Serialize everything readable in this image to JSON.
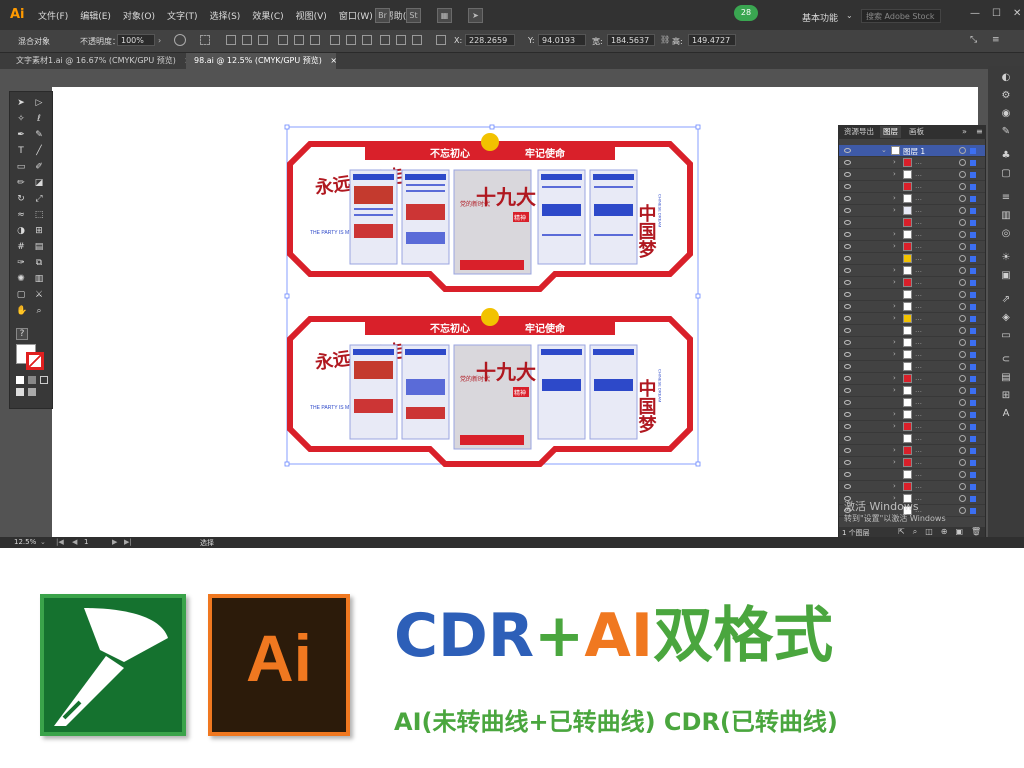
{
  "menubar": {
    "app_logo": "Ai",
    "menus": [
      "文件(F)",
      "编辑(E)",
      "对象(O)",
      "文字(T)",
      "选择(S)",
      "效果(C)",
      "视图(V)",
      "窗口(W)",
      "帮助(H)"
    ],
    "notification_count": "28",
    "workspace": "基本功能",
    "search_placeholder": "搜索 Adobe Stock"
  },
  "control_bar": {
    "selection_label": "混合对象",
    "opacity_label": "不透明度：",
    "opacity_value": "100%",
    "x_label": "X:",
    "x_value": "228.2659",
    "y_label": "Y:",
    "y_value": "94.0193",
    "w_label": "宽:",
    "w_value": "184.5637",
    "h_label": "高:",
    "h_value": "149.4727"
  },
  "tabs": [
    {
      "label": "文字素材1.ai @ 16.67% (CMYK/GPU 预览)",
      "active": false
    },
    {
      "label": "98.ai @ 12.5% (CMYK/GPU 预览)",
      "active": true
    }
  ],
  "status_bar": {
    "zoom": "12.5%",
    "artboard": "1",
    "tool_status": "选择"
  },
  "layers_panel": {
    "tabs": [
      "资源导出",
      "图层",
      "画板"
    ],
    "top_layer": "图层 1",
    "layer_count": "1 个图层",
    "accent_color": "#3c6ff2"
  },
  "artwork": {
    "banner_left": "不忘初心",
    "banner_right": "牢记使命",
    "left_slogan": "永远跟党走",
    "left_slogan_en": "THE PARTY IS MY HEART",
    "center_title": "十九大",
    "center_tag": "精神",
    "center_subtitle": "党的新时代",
    "right_slogan": "中国梦",
    "right_slogan_en": "CHINESE DREAM",
    "accent_red": "#d9202a",
    "accent_blue": "#2d49c9"
  },
  "watermark": {
    "activate_windows": "激活 Windows",
    "activate_hint": "转到\"设置\"以激活 Windows"
  },
  "promo": {
    "title_cdr": "CDR",
    "title_plus": "+",
    "title_ai": "AI",
    "title_format": "双格式",
    "subtitle": "AI(未转曲线+已转曲线) CDR(已转曲线)",
    "ai_icon_label": "Ai",
    "color_cdr": "#2d5fb8",
    "color_ai": "#f07820",
    "color_green": "#4aa63e"
  }
}
